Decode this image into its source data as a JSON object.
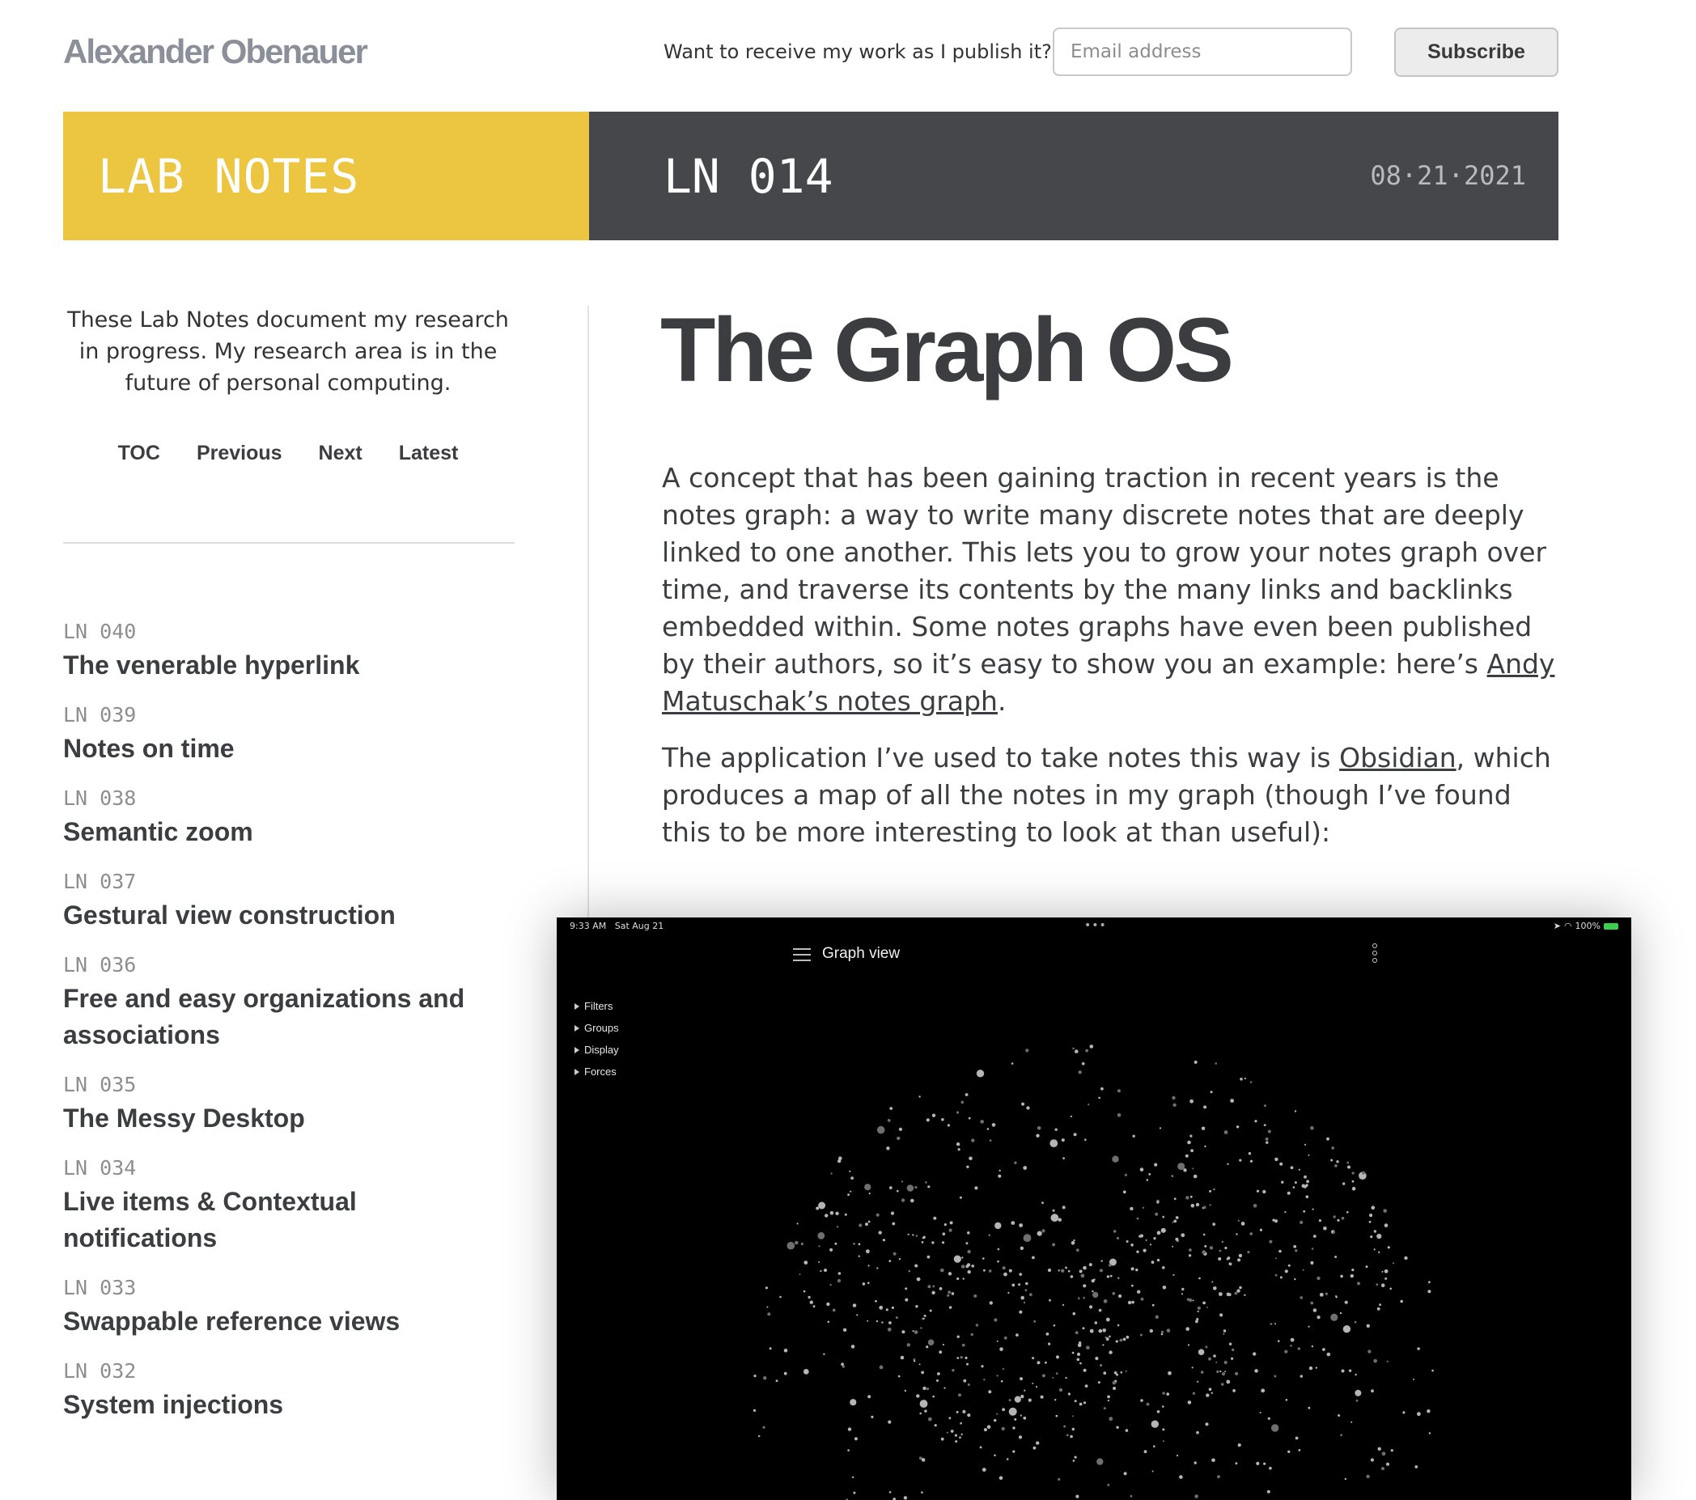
{
  "header": {
    "site_name": "Alexander Obenauer",
    "subscribe_prompt": "Want to receive my work as I publish it?",
    "email_placeholder": "Email address",
    "subscribe_label": "Subscribe"
  },
  "banner": {
    "section": "LAB NOTES",
    "number": "LN 014",
    "date": "08·21·2021",
    "colors": {
      "yellow": "#ecc541",
      "dark": "#46474b"
    }
  },
  "sidebar": {
    "intro": "These Lab Notes document my research in progress. My research area is in the future of personal computing.",
    "nav": [
      {
        "label": "TOC"
      },
      {
        "label": "Previous"
      },
      {
        "label": "Next"
      },
      {
        "label": "Latest"
      }
    ],
    "notes": [
      {
        "code": "LN 040",
        "title": "The venerable hyperlink"
      },
      {
        "code": "LN 039",
        "title": "Notes on time"
      },
      {
        "code": "LN 038",
        "title": "Semantic zoom"
      },
      {
        "code": "LN 037",
        "title": "Gestural view construction"
      },
      {
        "code": "LN 036",
        "title": "Free and easy organizations and associations"
      },
      {
        "code": "LN 035",
        "title": "The Messy Desktop"
      },
      {
        "code": "LN 034",
        "title": "Live items & Contextual notifications"
      },
      {
        "code": "LN 033",
        "title": "Swappable reference views"
      },
      {
        "code": "LN 032",
        "title": "System injections"
      }
    ]
  },
  "article": {
    "title": "The Graph OS",
    "p1_text": "A concept that has been gaining traction in recent years is the notes graph: a way to write many discrete notes that are deeply linked to one another. This lets you to grow your notes graph over time, and traverse its contents by the many links and backlinks embedded within. Some notes graphs have even been published by their authors, so it’s easy to show you an example: here’s ",
    "p1_link": "Andy Matuschak’s notes graph",
    "p1_end": ".",
    "p2_start": "The application I’ve used to take notes this way is ",
    "p2_link": "Obsidian",
    "p2_end": ", which produces a map of all the notes in my graph (though I’ve found this to be more interesting to look at than useful):"
  },
  "screenshot": {
    "time": "9:33 AM",
    "date": "Sat Aug 21",
    "battery": "100%",
    "title": "Graph view",
    "menu": [
      "Filters",
      "Groups",
      "Display",
      "Forces"
    ]
  }
}
